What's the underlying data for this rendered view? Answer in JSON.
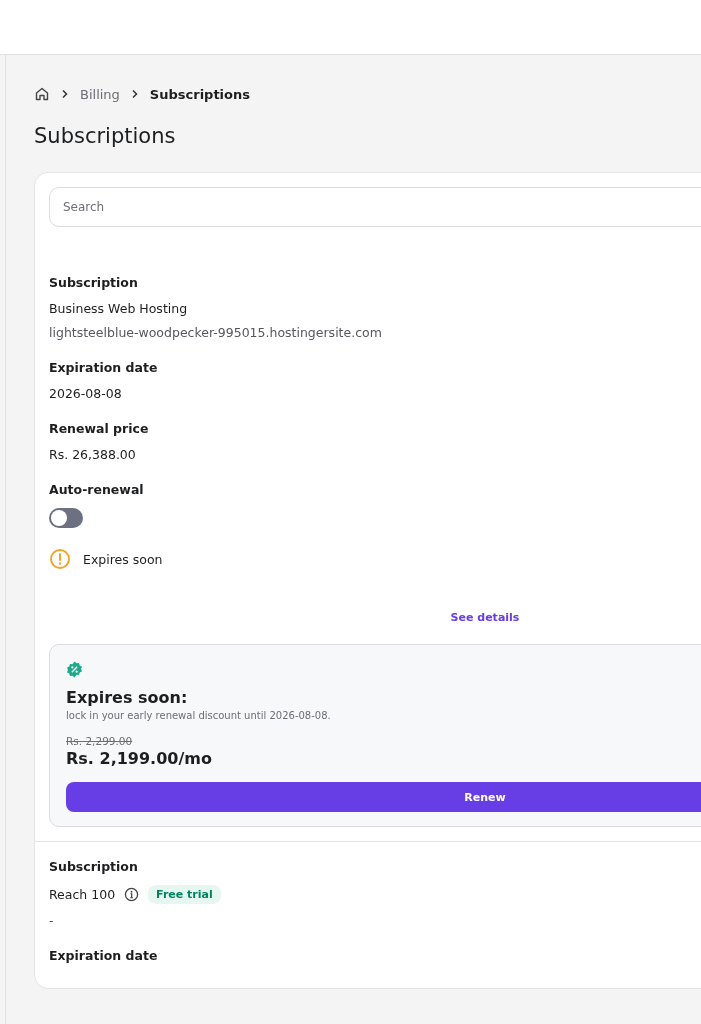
{
  "breadcrumb": [
    {
      "label": "Billing",
      "current": false
    },
    {
      "label": "Subscriptions",
      "current": true
    }
  ],
  "page_title": "Subscriptions",
  "search": {
    "placeholder": "Search"
  },
  "subscriptions": [
    {
      "subscription_label": "Subscription",
      "name": "Business Web Hosting",
      "info": false,
      "domain": "lightsteelblue-woodpecker-995015.hostingersite.com",
      "fields": [
        {
          "label": "Expiration date",
          "value": "2026-08-08"
        },
        {
          "label": "Renewal price",
          "value": "Rs. 26,388.00"
        }
      ],
      "auto_renewal": {
        "label": "Auto-renewal",
        "on": false
      },
      "status": {
        "kind": "warning",
        "text": "Expires soon"
      },
      "details_link": "See details",
      "offer": {
        "title": "Expires soon:",
        "text": "lock in your early renewal discount until 2026-08-08.",
        "old_price": "Rs. 2,299.00",
        "price": "Rs. 2,199.00/mo",
        "button": "Renew"
      }
    },
    {
      "subscription_label": "Subscription",
      "name": "Reach 100",
      "info": true,
      "badge": "Free trial",
      "domain": "-",
      "fields": [
        {
          "label": "Expiration date"
        }
      ]
    }
  ]
}
